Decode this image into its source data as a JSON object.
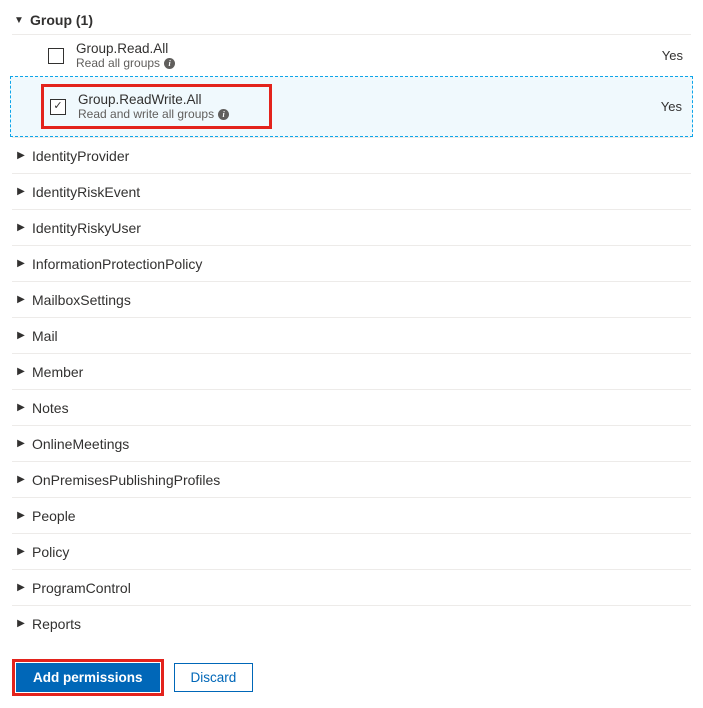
{
  "group": {
    "title": "Group (1)",
    "permissions": [
      {
        "name": "Group.Read.All",
        "desc": "Read all groups",
        "checked": false,
        "admin": "Yes",
        "highlighted": false
      },
      {
        "name": "Group.ReadWrite.All",
        "desc": "Read and write all groups",
        "checked": true,
        "admin": "Yes",
        "highlighted": true
      }
    ]
  },
  "categories": [
    "IdentityProvider",
    "IdentityRiskEvent",
    "IdentityRiskyUser",
    "InformationProtectionPolicy",
    "MailboxSettings",
    "Mail",
    "Member",
    "Notes",
    "OnlineMeetings",
    "OnPremisesPublishingProfiles",
    "People",
    "Policy",
    "ProgramControl",
    "Reports"
  ],
  "buttons": {
    "add": "Add permissions",
    "discard": "Discard"
  },
  "glyphs": {
    "down": "▼",
    "right": "▶",
    "check": "✓",
    "info": "i"
  }
}
